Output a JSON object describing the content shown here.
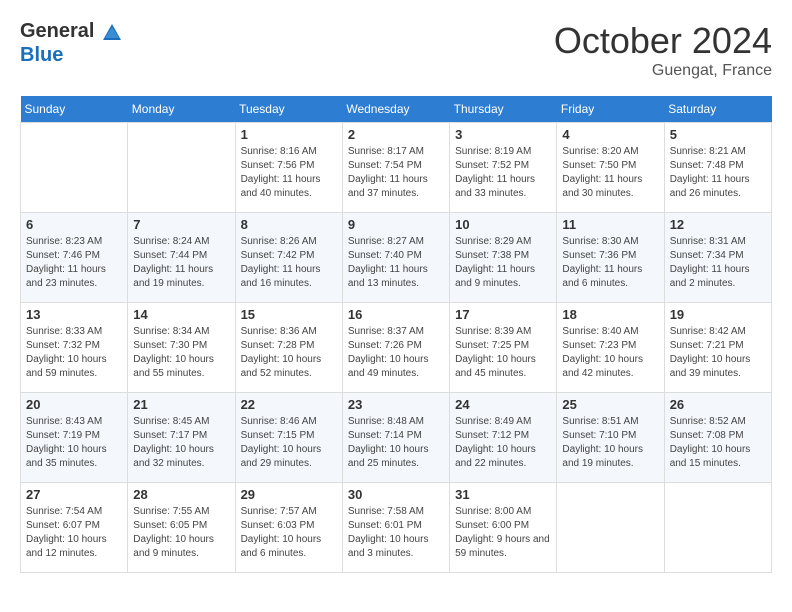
{
  "header": {
    "logo_general": "General",
    "logo_blue": "Blue",
    "month_title": "October 2024",
    "location": "Guengat, France"
  },
  "days_of_week": [
    "Sunday",
    "Monday",
    "Tuesday",
    "Wednesday",
    "Thursday",
    "Friday",
    "Saturday"
  ],
  "weeks": [
    [
      {
        "day": "",
        "sunrise": "",
        "sunset": "",
        "daylight": ""
      },
      {
        "day": "",
        "sunrise": "",
        "sunset": "",
        "daylight": ""
      },
      {
        "day": "1",
        "sunrise": "Sunrise: 8:16 AM",
        "sunset": "Sunset: 7:56 PM",
        "daylight": "Daylight: 11 hours and 40 minutes."
      },
      {
        "day": "2",
        "sunrise": "Sunrise: 8:17 AM",
        "sunset": "Sunset: 7:54 PM",
        "daylight": "Daylight: 11 hours and 37 minutes."
      },
      {
        "day": "3",
        "sunrise": "Sunrise: 8:19 AM",
        "sunset": "Sunset: 7:52 PM",
        "daylight": "Daylight: 11 hours and 33 minutes."
      },
      {
        "day": "4",
        "sunrise": "Sunrise: 8:20 AM",
        "sunset": "Sunset: 7:50 PM",
        "daylight": "Daylight: 11 hours and 30 minutes."
      },
      {
        "day": "5",
        "sunrise": "Sunrise: 8:21 AM",
        "sunset": "Sunset: 7:48 PM",
        "daylight": "Daylight: 11 hours and 26 minutes."
      }
    ],
    [
      {
        "day": "6",
        "sunrise": "Sunrise: 8:23 AM",
        "sunset": "Sunset: 7:46 PM",
        "daylight": "Daylight: 11 hours and 23 minutes."
      },
      {
        "day": "7",
        "sunrise": "Sunrise: 8:24 AM",
        "sunset": "Sunset: 7:44 PM",
        "daylight": "Daylight: 11 hours and 19 minutes."
      },
      {
        "day": "8",
        "sunrise": "Sunrise: 8:26 AM",
        "sunset": "Sunset: 7:42 PM",
        "daylight": "Daylight: 11 hours and 16 minutes."
      },
      {
        "day": "9",
        "sunrise": "Sunrise: 8:27 AM",
        "sunset": "Sunset: 7:40 PM",
        "daylight": "Daylight: 11 hours and 13 minutes."
      },
      {
        "day": "10",
        "sunrise": "Sunrise: 8:29 AM",
        "sunset": "Sunset: 7:38 PM",
        "daylight": "Daylight: 11 hours and 9 minutes."
      },
      {
        "day": "11",
        "sunrise": "Sunrise: 8:30 AM",
        "sunset": "Sunset: 7:36 PM",
        "daylight": "Daylight: 11 hours and 6 minutes."
      },
      {
        "day": "12",
        "sunrise": "Sunrise: 8:31 AM",
        "sunset": "Sunset: 7:34 PM",
        "daylight": "Daylight: 11 hours and 2 minutes."
      }
    ],
    [
      {
        "day": "13",
        "sunrise": "Sunrise: 8:33 AM",
        "sunset": "Sunset: 7:32 PM",
        "daylight": "Daylight: 10 hours and 59 minutes."
      },
      {
        "day": "14",
        "sunrise": "Sunrise: 8:34 AM",
        "sunset": "Sunset: 7:30 PM",
        "daylight": "Daylight: 10 hours and 55 minutes."
      },
      {
        "day": "15",
        "sunrise": "Sunrise: 8:36 AM",
        "sunset": "Sunset: 7:28 PM",
        "daylight": "Daylight: 10 hours and 52 minutes."
      },
      {
        "day": "16",
        "sunrise": "Sunrise: 8:37 AM",
        "sunset": "Sunset: 7:26 PM",
        "daylight": "Daylight: 10 hours and 49 minutes."
      },
      {
        "day": "17",
        "sunrise": "Sunrise: 8:39 AM",
        "sunset": "Sunset: 7:25 PM",
        "daylight": "Daylight: 10 hours and 45 minutes."
      },
      {
        "day": "18",
        "sunrise": "Sunrise: 8:40 AM",
        "sunset": "Sunset: 7:23 PM",
        "daylight": "Daylight: 10 hours and 42 minutes."
      },
      {
        "day": "19",
        "sunrise": "Sunrise: 8:42 AM",
        "sunset": "Sunset: 7:21 PM",
        "daylight": "Daylight: 10 hours and 39 minutes."
      }
    ],
    [
      {
        "day": "20",
        "sunrise": "Sunrise: 8:43 AM",
        "sunset": "Sunset: 7:19 PM",
        "daylight": "Daylight: 10 hours and 35 minutes."
      },
      {
        "day": "21",
        "sunrise": "Sunrise: 8:45 AM",
        "sunset": "Sunset: 7:17 PM",
        "daylight": "Daylight: 10 hours and 32 minutes."
      },
      {
        "day": "22",
        "sunrise": "Sunrise: 8:46 AM",
        "sunset": "Sunset: 7:15 PM",
        "daylight": "Daylight: 10 hours and 29 minutes."
      },
      {
        "day": "23",
        "sunrise": "Sunrise: 8:48 AM",
        "sunset": "Sunset: 7:14 PM",
        "daylight": "Daylight: 10 hours and 25 minutes."
      },
      {
        "day": "24",
        "sunrise": "Sunrise: 8:49 AM",
        "sunset": "Sunset: 7:12 PM",
        "daylight": "Daylight: 10 hours and 22 minutes."
      },
      {
        "day": "25",
        "sunrise": "Sunrise: 8:51 AM",
        "sunset": "Sunset: 7:10 PM",
        "daylight": "Daylight: 10 hours and 19 minutes."
      },
      {
        "day": "26",
        "sunrise": "Sunrise: 8:52 AM",
        "sunset": "Sunset: 7:08 PM",
        "daylight": "Daylight: 10 hours and 15 minutes."
      }
    ],
    [
      {
        "day": "27",
        "sunrise": "Sunrise: 7:54 AM",
        "sunset": "Sunset: 6:07 PM",
        "daylight": "Daylight: 10 hours and 12 minutes."
      },
      {
        "day": "28",
        "sunrise": "Sunrise: 7:55 AM",
        "sunset": "Sunset: 6:05 PM",
        "daylight": "Daylight: 10 hours and 9 minutes."
      },
      {
        "day": "29",
        "sunrise": "Sunrise: 7:57 AM",
        "sunset": "Sunset: 6:03 PM",
        "daylight": "Daylight: 10 hours and 6 minutes."
      },
      {
        "day": "30",
        "sunrise": "Sunrise: 7:58 AM",
        "sunset": "Sunset: 6:01 PM",
        "daylight": "Daylight: 10 hours and 3 minutes."
      },
      {
        "day": "31",
        "sunrise": "Sunrise: 8:00 AM",
        "sunset": "Sunset: 6:00 PM",
        "daylight": "Daylight: 9 hours and 59 minutes."
      },
      {
        "day": "",
        "sunrise": "",
        "sunset": "",
        "daylight": ""
      },
      {
        "day": "",
        "sunrise": "",
        "sunset": "",
        "daylight": ""
      }
    ]
  ]
}
